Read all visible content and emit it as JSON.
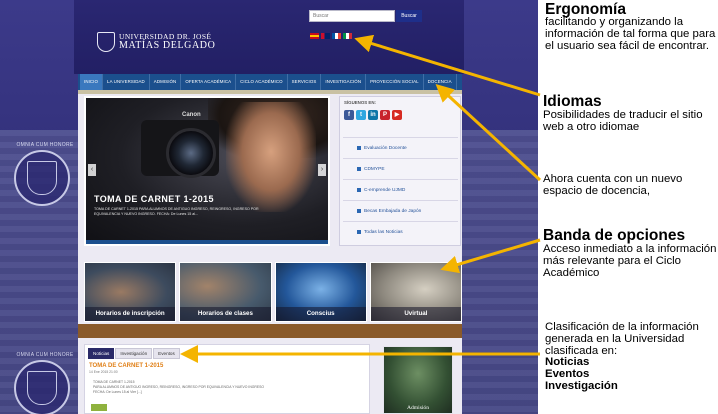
{
  "site": {
    "logo_line1": "UNIVERSIDAD DR. JOSÉ",
    "logo_line2": "MATÍAS DELGADO",
    "search_placeholder": "Buscar",
    "search_button": "Buscar",
    "flags": [
      "es",
      "en",
      "fr",
      "it"
    ],
    "watermark_text": "OMNIA CUM HONORE",
    "nav": [
      "INICIO",
      "LA UNIVERSIDAD",
      "ADMISIÓN",
      "OFERTA ACADÉMICA",
      "CICLO ACADÉMICO",
      "SERVICIOS",
      "INVESTIGACIÓN",
      "PROYECCIÓN SOCIAL",
      "DOCENCIA"
    ],
    "nav_active_index": 0,
    "slide": {
      "brand": "Canon",
      "title": "TOMA DE CARNET 1-2015",
      "desc": "TOMA DE CARNET 1-2015 PARA ALUMNOS DE ANTIGUO INGRESO, REINGRESO, INGRESO POR EQUIVALENCIA Y NUEVO INGRESO. FECHA: De Lunes 15 al..."
    },
    "siguenos": "SÍGUENOS EN:",
    "social_icons": [
      "facebook-icon",
      "twitter-icon",
      "linkedin-icon",
      "pinterest-icon",
      "youtube-icon"
    ],
    "side_links": [
      "Evaluación Docente",
      "CDMYPE",
      "C-emprende UJMD",
      "Becas Embajada de Japón",
      "Todas las Noticias"
    ],
    "thumbs": [
      "Horarios de inscripción",
      "Horarios de clases",
      "Conscius",
      "Uvirtual"
    ],
    "news": {
      "tabs": [
        "Noticias",
        "Investigación",
        "Eventos"
      ],
      "active_tab": 0,
      "title": "TOMA DE CARNET 1-2015",
      "date": "14 Ene 2015 21:00",
      "body_line1": "TOMA DE CARNET 1-2015",
      "body_line2": "PARA ALUMNOS DE ANTIGUO INGRESO, REINGRESO, INGRESO POR EQUIVALENCIA Y NUEVO INGRESO",
      "body_line3": "FECHA: De Lunes 15 al Vier [...]"
    },
    "admision_label": "Admisión"
  },
  "annotations": {
    "ergonomia_title": "Ergonomía",
    "ergonomia_desc": "facilitando y organizando la información de tal forma que para el usuario sea fácil de encontrar.",
    "idiomas_title": "Idiomas",
    "idiomas_desc": "Posibilidades de traducir el sitio web a otro idiomae",
    "docencia_desc": "Ahora cuenta con un nuevo espacio de docencia,",
    "banda_title": "Banda de opciones",
    "banda_desc": "Acceso inmediato a la información más relevante para el Ciclo Académico",
    "clasificacion_desc": "Clasificación de la información generada en la Universidad clasificada en:",
    "clasificacion_items": [
      "Noticias",
      "Eventos",
      "Investigación"
    ]
  },
  "colors": {
    "arrow": "#f4b400",
    "nav_bar": "#1b4f8d",
    "news_title": "#e07f16"
  }
}
